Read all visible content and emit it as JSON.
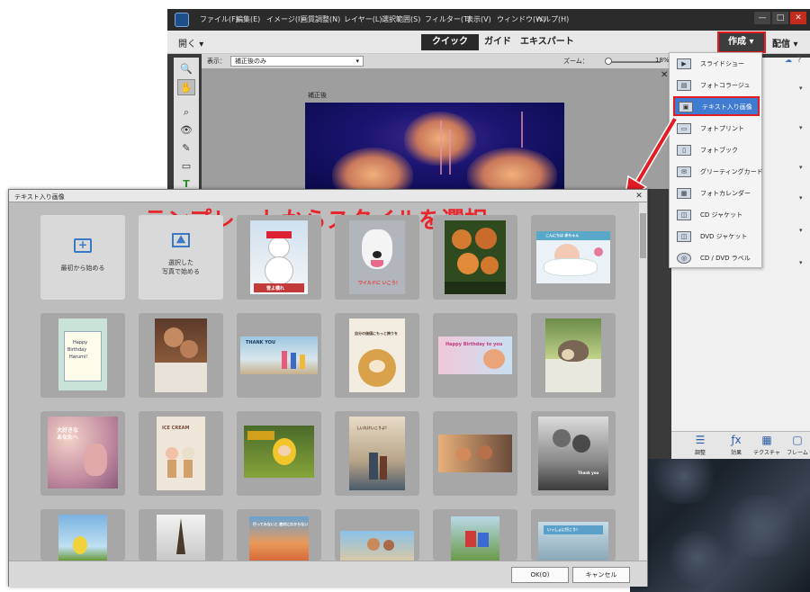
{
  "menu": [
    "ファイル(F)",
    "編集(E)",
    "イメージ(I)",
    "画質調整(N)",
    "レイヤー(L)",
    "選択範囲(S)",
    "フィルター(T)",
    "表示(V)",
    "ウィンドウ(W)",
    "ヘルプ(H)"
  ],
  "window_buttons": [
    "—",
    "□",
    "✕"
  ],
  "modebar": {
    "open": "開く",
    "tabs": [
      "クイック",
      "ガイド",
      "エキスパート"
    ],
    "create": "作成",
    "share": "配信"
  },
  "options": {
    "view_label": "表示：",
    "view_value": "補正後のみ",
    "zoom_label": "ズーム：",
    "zoom_value": "18%"
  },
  "canvas": {
    "after_label": "補正後"
  },
  "create_menu": [
    {
      "label": "スライドショー",
      "icon": "slideshow-icon"
    },
    {
      "label": "フォトコラージュ",
      "icon": "collage-icon"
    },
    {
      "label": "テキスト入り画像",
      "icon": "text-image-icon"
    },
    {
      "label": "フォトプリント",
      "icon": "print-icon"
    },
    {
      "label": "フォトブック",
      "icon": "photobook-icon"
    },
    {
      "label": "グリーティングカード",
      "icon": "greeting-card-icon"
    },
    {
      "label": "フォトカレンダー",
      "icon": "calendar-icon"
    },
    {
      "label": "CD ジャケット",
      "icon": "cd-jacket-icon"
    },
    {
      "label": "DVD ジャケット",
      "icon": "dvd-jacket-icon"
    },
    {
      "label": "CD / DVD ラベル",
      "icon": "disc-label-icon"
    }
  ],
  "bottom_bar": [
    "調整",
    "効果",
    "テクスチャ",
    "フレーム"
  ],
  "dialog": {
    "title": "テキスト入り画像",
    "banner": "テンプレートからスタイルを選択",
    "start_blank": "最初から始める",
    "start_photo": [
      "選択した",
      "写真で始める"
    ],
    "ok": "OK(O)",
    "cancel": "キャンセル"
  },
  "template_captions": {
    "t_snow": "雪よ積れ",
    "t_dog": "ワイルドに いこう！",
    "t_baby": "こんにちは 赤ちゃん",
    "t_birthday": [
      "Happy",
      "Birthday",
      "Harumi!"
    ],
    "t_thank": "THANK YOU",
    "t_friends": "自分の価値にもっと誇りを",
    "t_hbd": "Happy Birthday to you",
    "t_love": [
      "大好きな",
      "あなたへ"
    ],
    "t_ice": "ICE CREAM",
    "t_river": "しいたけいこうよ!",
    "t_couple": "Thank you",
    "t_family": "いっしょに行こう！",
    "t_go": "行ってみないと 絶対にわからない"
  }
}
